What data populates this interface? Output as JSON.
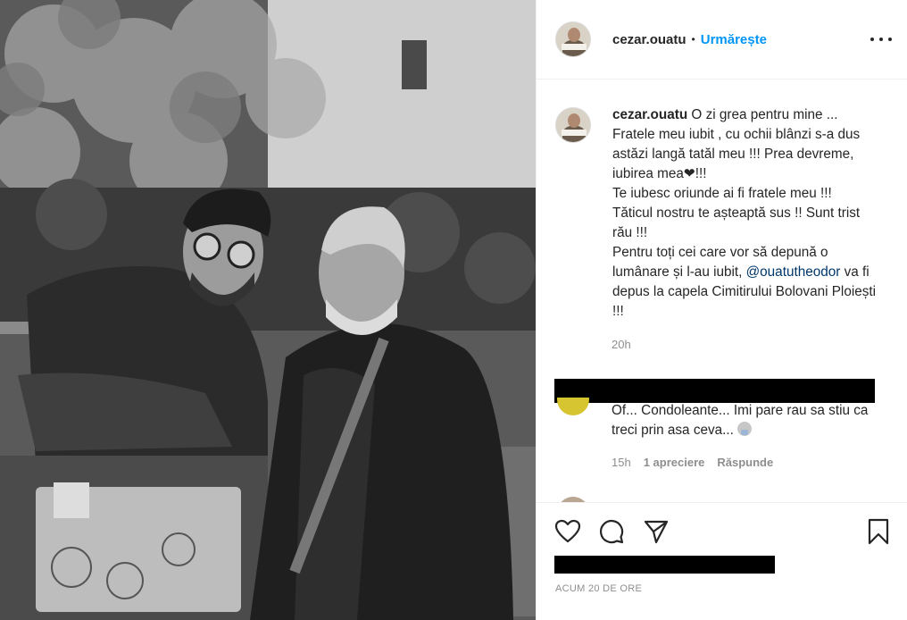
{
  "header": {
    "username": "cezar.ouatu",
    "separator": "•",
    "follow_label": "Urmărește"
  },
  "caption": {
    "username": "cezar.ouatu",
    "line1": "O zi grea pentru mine ... Fratele meu iubit , cu ochii blânzi s-a dus astăzi langă tatăl meu !!! Prea devreme, iubirea mea❤!!!",
    "line2": "Te iubesc oriunde ai fi fratele meu !!!",
    "line3": "Tăticul nostru te așteaptă sus !! Sunt trist rău !!!",
    "line4_pre": "Pentru toți cei care vor să depună o lumânare și l-au iubit,",
    "mention": "@ouatutheodor",
    "line4_post": "va fi depus la capela Cimitirului Bolovani Ploiești !!!",
    "time": "20h"
  },
  "comment": {
    "text": "Of... Condoleante... Imi pare rau sa stiu ca treci prin asa ceva...",
    "emoji": "person-emoji",
    "time": "15h",
    "likes": "1 apreciere",
    "reply_label": "Răspunde"
  },
  "footer": {
    "date": "ACUM 20 DE ORE"
  },
  "icons": {
    "like": "heart-icon",
    "comment": "comment-icon",
    "share": "share-icon",
    "save": "bookmark-icon",
    "more": "more-icon"
  }
}
